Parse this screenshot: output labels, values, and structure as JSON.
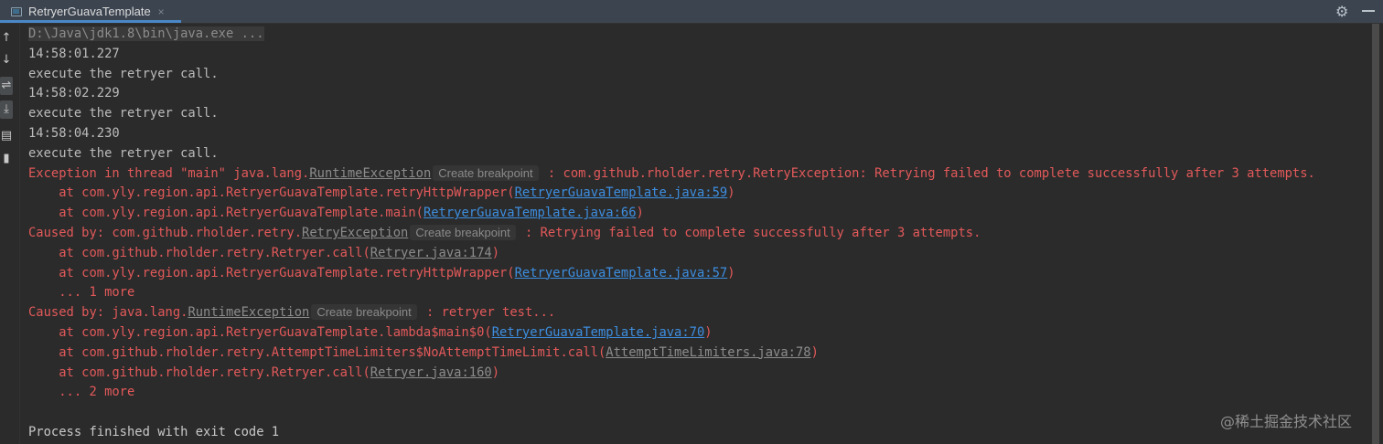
{
  "tab": {
    "title": "RetryerGuavaTemplate",
    "close": "×"
  },
  "toolbar": {
    "settings_icon": "gear-icon",
    "minimize_icon": "minimize-icon"
  },
  "left_toolbar": [
    "up-arrow-icon",
    "down-arrow-icon",
    "soft-wrap-icon",
    "scroll-to-end-icon",
    "print-icon",
    "trash-icon"
  ],
  "colors": {
    "error": "#e3595a",
    "link": "#3d8ee0",
    "background": "#2b2b2b",
    "titlebar": "#3c4450"
  },
  "console": {
    "lines": [
      [
        {
          "t": "D:\\Java\\jdk1.8\\bin\\java.exe ...",
          "k": "cmd"
        }
      ],
      [
        {
          "t": "14:58:01.227"
        }
      ],
      [
        {
          "t": "execute the retryer call."
        }
      ],
      [
        {
          "t": "14:58:02.229"
        }
      ],
      [
        {
          "t": "execute the retryer call."
        }
      ],
      [
        {
          "t": "14:58:04.230"
        }
      ],
      [
        {
          "t": "execute the retryer call."
        }
      ],
      [
        {
          "t": "Exception in thread \"main\" java.lang.",
          "k": "err"
        },
        {
          "t": "RuntimeException",
          "k": "glink"
        },
        {
          "t": "Create breakpoint",
          "k": "bp"
        },
        {
          "t": " : com.github.rholder.retry.RetryException: Retrying failed to complete successfully after 3 attempts.",
          "k": "err"
        }
      ],
      [
        {
          "t": "    at com.yly.region.api.RetryerGuavaTemplate.retryHttpWrapper(",
          "k": "err"
        },
        {
          "t": "RetryerGuavaTemplate.java:59",
          "k": "link"
        },
        {
          "t": ")",
          "k": "err"
        }
      ],
      [
        {
          "t": "    at com.yly.region.api.RetryerGuavaTemplate.main(",
          "k": "err"
        },
        {
          "t": "RetryerGuavaTemplate.java:66",
          "k": "link"
        },
        {
          "t": ")",
          "k": "err"
        }
      ],
      [
        {
          "t": "Caused by: com.github.rholder.retry.",
          "k": "err"
        },
        {
          "t": "RetryException",
          "k": "glink"
        },
        {
          "t": "Create breakpoint",
          "k": "bp"
        },
        {
          "t": " : Retrying failed to complete successfully after 3 attempts.",
          "k": "err"
        }
      ],
      [
        {
          "t": "    at com.github.rholder.retry.Retryer.call(",
          "k": "err"
        },
        {
          "t": "Retryer.java:174",
          "k": "glink"
        },
        {
          "t": ")",
          "k": "err"
        }
      ],
      [
        {
          "t": "    at com.yly.region.api.RetryerGuavaTemplate.retryHttpWrapper(",
          "k": "err"
        },
        {
          "t": "RetryerGuavaTemplate.java:57",
          "k": "link"
        },
        {
          "t": ")",
          "k": "err"
        }
      ],
      [
        {
          "t": "    ... 1 more",
          "k": "err"
        }
      ],
      [
        {
          "t": "Caused by: java.lang.",
          "k": "err"
        },
        {
          "t": "RuntimeException",
          "k": "glink"
        },
        {
          "t": "Create breakpoint",
          "k": "bp"
        },
        {
          "t": " : retryer test...",
          "k": "err"
        }
      ],
      [
        {
          "t": "    at com.yly.region.api.RetryerGuavaTemplate.lambda$main$0(",
          "k": "err"
        },
        {
          "t": "RetryerGuavaTemplate.java:70",
          "k": "link"
        },
        {
          "t": ")",
          "k": "err"
        }
      ],
      [
        {
          "t": "    at com.github.rholder.retry.AttemptTimeLimiters$NoAttemptTimeLimit.call(",
          "k": "err"
        },
        {
          "t": "AttemptTimeLimiters.java:78",
          "k": "glink"
        },
        {
          "t": ")",
          "k": "err"
        }
      ],
      [
        {
          "t": "    at com.github.rholder.retry.Retryer.call(",
          "k": "err"
        },
        {
          "t": "Retryer.java:160",
          "k": "glink"
        },
        {
          "t": ")",
          "k": "err"
        }
      ],
      [
        {
          "t": "    ... 2 more",
          "k": "err"
        }
      ],
      [
        {
          "t": ""
        }
      ],
      [
        {
          "t": "Process finished with exit code 1",
          "k": "white"
        }
      ]
    ]
  },
  "watermark": "@稀土掘金技术社区"
}
